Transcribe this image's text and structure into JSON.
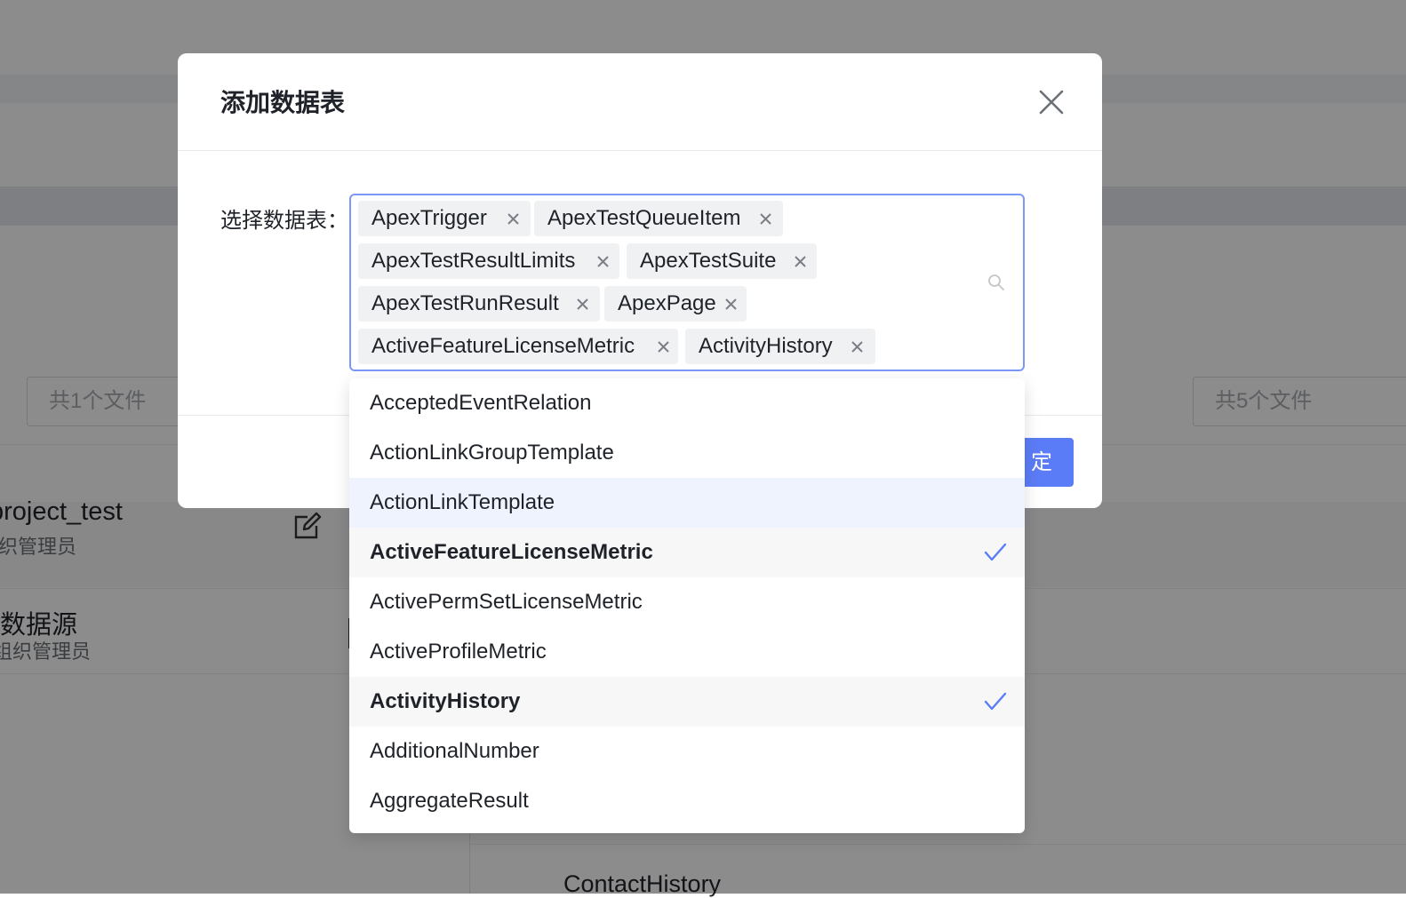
{
  "background": {
    "left_file_count": "共1个文件",
    "right_file_count": "共5个文件",
    "project_name": "project_test",
    "project_role": "织管理员",
    "datasource_name": "数据源",
    "datasource_role": "组织管理员",
    "table_item": "ContactHistory"
  },
  "modal": {
    "title": "添加数据表",
    "field_label": "选择数据表：",
    "ok_label": "定"
  },
  "selected_tags": [
    "ApexTrigger",
    "ApexTestQueueItem",
    "ApexTestResultLimits",
    "ApexTestSuite",
    "ApexTestRunResult",
    "ApexPage",
    "ActiveFeatureLicenseMetric",
    "ActivityHistory"
  ],
  "options": [
    {
      "label": "AcceptedEventRelation",
      "state": "normal"
    },
    {
      "label": "ActionLinkGroupTemplate",
      "state": "normal"
    },
    {
      "label": "ActionLinkTemplate",
      "state": "hover"
    },
    {
      "label": "ActiveFeatureLicenseMetric",
      "state": "selected"
    },
    {
      "label": "ActivePermSetLicenseMetric",
      "state": "normal"
    },
    {
      "label": "ActiveProfileMetric",
      "state": "normal"
    },
    {
      "label": "ActivityHistory",
      "state": "selected"
    },
    {
      "label": "AdditionalNumber",
      "state": "normal"
    },
    {
      "label": "AggregateResult",
      "state": "normal"
    }
  ],
  "colors": {
    "accent": "#5b7cf7",
    "focus_border": "#7d97f9",
    "hover_row": "#eef3fd",
    "selected_row": "#f7f7f8",
    "tag_bg": "#f0f1f3"
  },
  "icons": {
    "close": "close-icon",
    "tag_remove": "x-icon",
    "search": "search-icon",
    "check": "check-icon",
    "edit": "edit-icon"
  }
}
